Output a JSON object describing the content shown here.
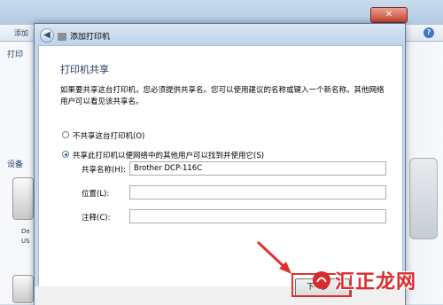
{
  "background_window": {
    "toolbar_left_label": "添加",
    "section_printers": "打印",
    "section_devices": "设备",
    "device_label_line1": "De",
    "device_label_line2": "US",
    "help_label": "?",
    "close_label": "✕"
  },
  "dialog": {
    "title": "添加打印机",
    "back_label": "◀",
    "heading": "打印机共享",
    "description": "如果要共享这台打印机，您必须提供共享名。您可以使用建议的名称或键入一个新名称。其他网络用户可以看见该共享名。",
    "options": [
      {
        "label": "不共享这台打印机(O)",
        "checked": false
      },
      {
        "label": "共享此打印机以便网络中的其他用户可以找到并使用它(S)",
        "checked": true
      }
    ],
    "fields": {
      "share_name": {
        "label": "共享名称(H):",
        "value": "Brother DCP-116C"
      },
      "location": {
        "label": "位置(L):",
        "value": ""
      },
      "comment": {
        "label": "注释(C):",
        "value": ""
      }
    },
    "next_button": "下一步"
  },
  "watermark": {
    "text": "汇正龙网"
  },
  "colors": {
    "highlight": "#e0312e",
    "heading": "#1e395b",
    "accent": "#2a5fa8"
  }
}
